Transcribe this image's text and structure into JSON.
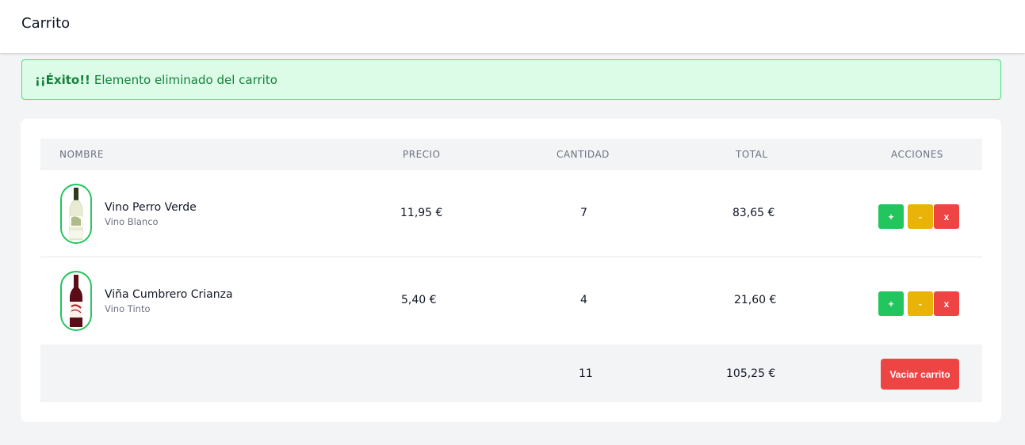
{
  "header": {
    "title": "Carrito"
  },
  "alert": {
    "strong": "¡¡Éxito!!",
    "message": "Elemento eliminado del carrito"
  },
  "table": {
    "columns": {
      "name": "NOMBRE",
      "price": "PRECIO",
      "quantity": "CANTIDAD",
      "total": "TOTAL",
      "actions": "ACCIONES"
    },
    "rows": [
      {
        "name": "Vino Perro Verde",
        "category": "Vino Blanco",
        "price": "11,95 €",
        "quantity": "7",
        "total": "83,65 €",
        "image": "white-wine-bottle-icon"
      },
      {
        "name": "Viña Cumbrero Crianza",
        "category": "Vino Tinto",
        "price": "5,40 €",
        "quantity": "4",
        "total": "21,60 €",
        "image": "red-wine-bottle-icon"
      }
    ],
    "actions": {
      "plus": "+",
      "minus": "-",
      "remove": "x"
    },
    "footer": {
      "total_quantity": "11",
      "total_amount": "105,25 €",
      "empty_button": "Vaciar carrito"
    }
  },
  "colors": {
    "success": "#22c55e",
    "warning": "#eab308",
    "danger": "#ef4444",
    "alert_bg": "#dcfce7",
    "alert_text": "#15803d"
  }
}
